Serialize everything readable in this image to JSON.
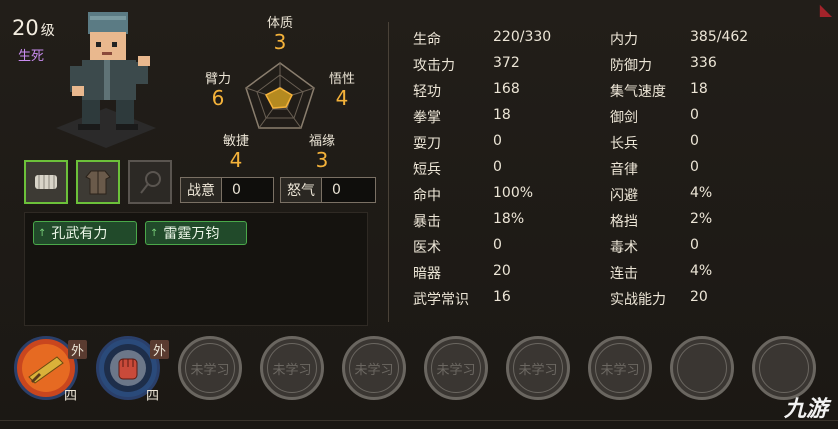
{
  "character": {
    "level": "20",
    "level_unit": "级",
    "status": "生死"
  },
  "attributes": [
    {
      "name": "体质",
      "value": "3"
    },
    {
      "name": "悟性",
      "value": "4"
    },
    {
      "name": "福缘",
      "value": "3"
    },
    {
      "name": "敏捷",
      "value": "4"
    },
    {
      "name": "臂力",
      "value": "6"
    }
  ],
  "resources": {
    "battle_intent_label": "战意",
    "battle_intent_value": "0",
    "rage_label": "怒气",
    "rage_value": "0"
  },
  "traits": [
    "孔武有力",
    "雷霆万钧"
  ],
  "stats_left": [
    {
      "label": "生命",
      "value": "220/330"
    },
    {
      "label": "攻击力",
      "value": "372"
    },
    {
      "label": "轻功",
      "value": "168"
    },
    {
      "label": "拳掌",
      "value": "18"
    },
    {
      "label": "耍刀",
      "value": "0"
    },
    {
      "label": "短兵",
      "value": "0"
    },
    {
      "label": "命中",
      "value": "100%"
    },
    {
      "label": "暴击",
      "value": "18%"
    },
    {
      "label": "医术",
      "value": "0"
    },
    {
      "label": "暗器",
      "value": "20"
    },
    {
      "label": "武学常识",
      "value": "16"
    }
  ],
  "stats_right": [
    {
      "label": "内力",
      "value": "385/462"
    },
    {
      "label": "防御力",
      "value": "336"
    },
    {
      "label": "集气速度",
      "value": "18"
    },
    {
      "label": "御剑",
      "value": "0"
    },
    {
      "label": "长兵",
      "value": "0"
    },
    {
      "label": "音律",
      "value": "0"
    },
    {
      "label": "闪避",
      "value": "4%"
    },
    {
      "label": "格挡",
      "value": "2%"
    },
    {
      "label": "毒术",
      "value": "0"
    },
    {
      "label": "连击",
      "value": "4%"
    },
    {
      "label": "实战能力",
      "value": "20"
    }
  ],
  "skills": {
    "learned": [
      {
        "type": "外",
        "tier": "四"
      },
      {
        "type": "外",
        "tier": "四"
      }
    ],
    "unlearned_label": "未学习"
  },
  "watermark": "九游",
  "colors": {
    "accent": "#f4b23a",
    "equip_border": "#6cc13a",
    "trait_bg": "#214a2a",
    "status": "#c98cf0"
  }
}
